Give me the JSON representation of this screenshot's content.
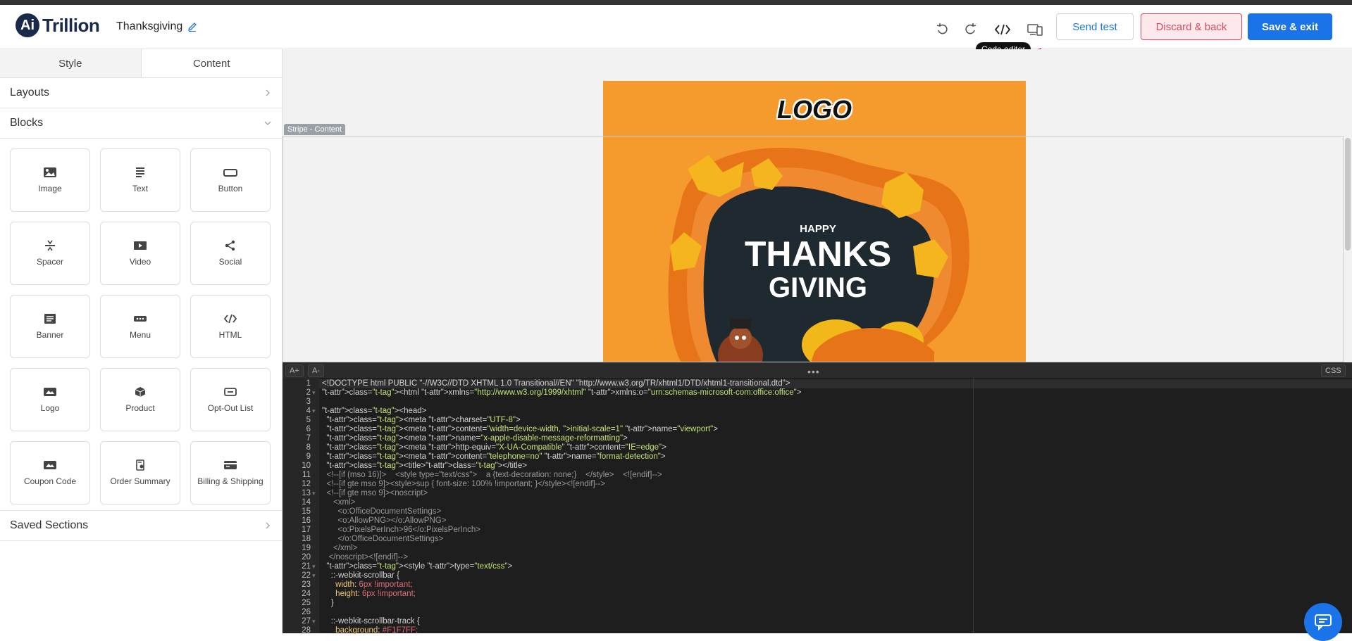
{
  "app": {
    "logo_mark": "Ai",
    "logo_text": "Trillion",
    "doc_title": "Thanksgiving"
  },
  "toolbar": {
    "send_test": "Send test",
    "discard": "Discard & back",
    "save_exit": "Save & exit",
    "tooltip": "Code editor"
  },
  "sidebar": {
    "tabs": [
      {
        "label": "Style"
      },
      {
        "label": "Content"
      }
    ],
    "layouts_label": "Layouts",
    "blocks_label": "Blocks",
    "saved_label": "Saved Sections",
    "blocks": [
      {
        "label": "Image",
        "icon": "image-icon"
      },
      {
        "label": "Text",
        "icon": "text-icon"
      },
      {
        "label": "Button",
        "icon": "button-icon"
      },
      {
        "label": "Spacer",
        "icon": "spacer-icon"
      },
      {
        "label": "Video",
        "icon": "video-icon"
      },
      {
        "label": "Social",
        "icon": "share-icon"
      },
      {
        "label": "Banner",
        "icon": "banner-icon"
      },
      {
        "label": "Menu",
        "icon": "menu-icon"
      },
      {
        "label": "HTML",
        "icon": "code-icon"
      },
      {
        "label": "Logo",
        "icon": "logo-icon"
      },
      {
        "label": "Product",
        "icon": "product-icon"
      },
      {
        "label": "Opt-Out List",
        "icon": "optout-icon"
      },
      {
        "label": "Coupon Code",
        "icon": "coupon-icon"
      },
      {
        "label": "Order Summary",
        "icon": "order-summary-icon"
      },
      {
        "label": "Billing & Shipping",
        "icon": "billing-icon"
      }
    ]
  },
  "canvas": {
    "stripe_label": "Stripe - Content",
    "email_logo": "LOGO",
    "banner_happy": "HAPPY",
    "banner_thanks": "THANKS",
    "banner_giving": "GIVING"
  },
  "editor": {
    "font_up": "A+",
    "font_down": "A-",
    "grip": "•••",
    "css_label": "CSS",
    "line_numbers": [
      "1",
      "2",
      "3",
      "4",
      "5",
      "6",
      "7",
      "8",
      "9",
      "10",
      "11",
      "12",
      "13",
      "14",
      "15",
      "16",
      "17",
      "18",
      "19",
      "20",
      "21",
      "22",
      "23",
      "24",
      "25",
      "26",
      "27",
      "28"
    ],
    "code": [
      "<!DOCTYPE html PUBLIC \"-//W3C//DTD XHTML 1.0 Transitional//EN\" \"http://www.w3.org/TR/xhtml1/DTD/xhtml1-transitional.dtd\">",
      "<html xmlns=\"http://www.w3.org/1999/xhtml\" xmlns:o=\"urn:schemas-microsoft-com:office:office\">",
      "",
      "<head>",
      "  <meta charset=\"UTF-8\">",
      "  <meta content=\"width=device-width, initial-scale=1\" name=\"viewport\">",
      "  <meta name=\"x-apple-disable-message-reformatting\">",
      "  <meta http-equiv=\"X-UA-Compatible\" content=\"IE=edge\">",
      "  <meta content=\"telephone=no\" name=\"format-detection\">",
      "  <title></title>",
      "  <!--[if (mso 16)]>    <style type=\"text/css\">    a {text-decoration: none;}    </style>    <![endif]-->",
      "  <!--[if gte mso 9]><style>sup { font-size: 100% !important; }</style><![endif]-->",
      "  <!--[if gte mso 9]><noscript>",
      "     <xml>",
      "       <o:OfficeDocumentSettings>",
      "       <o:AllowPNG></o:AllowPNG>",
      "       <o:PixelsPerInch>96</o:PixelsPerInch>",
      "       </o:OfficeDocumentSettings>",
      "     </xml>",
      "   </noscript><![endif]-->",
      "  <style type=\"text/css\">",
      "    ::-webkit-scrollbar {",
      "      width: 6px !important;",
      "      height: 6px !important;",
      "    }",
      "",
      "    ::-webkit-scrollbar-track {",
      "      background: #F1F7FF;"
    ]
  }
}
